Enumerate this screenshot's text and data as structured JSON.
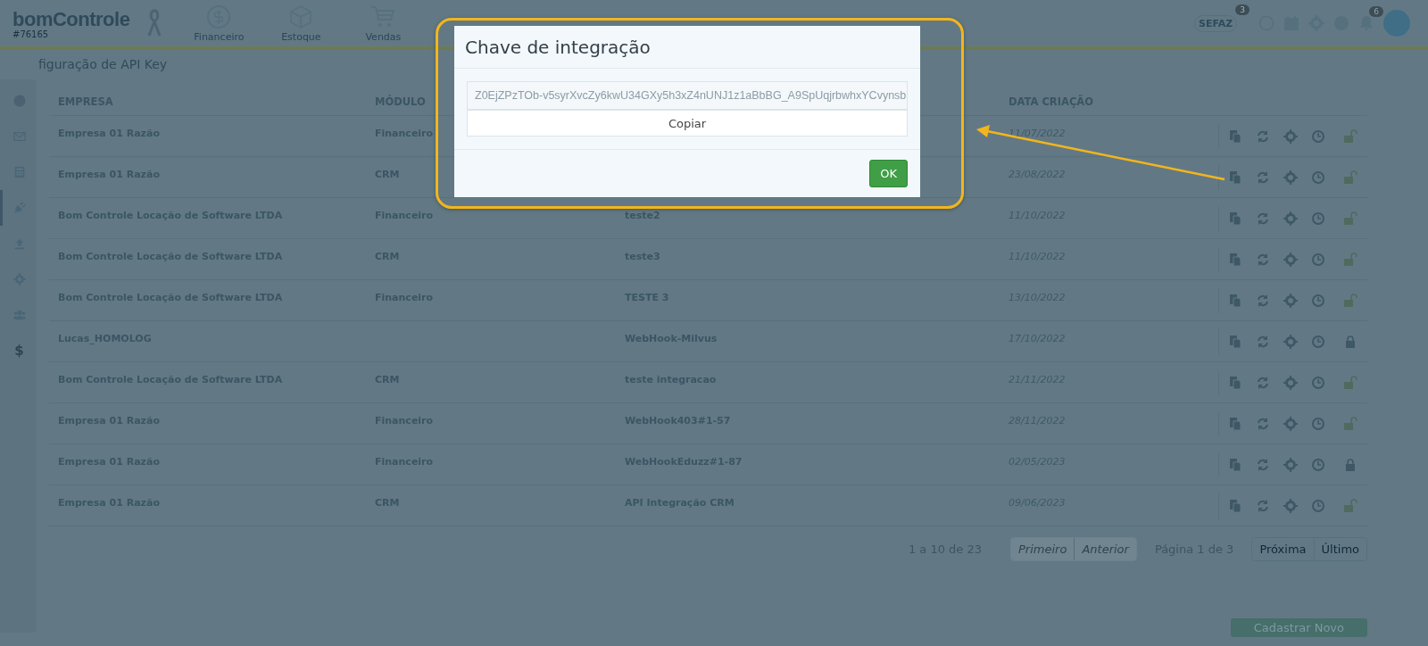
{
  "header": {
    "logo": "bomControle",
    "account": "#76165",
    "nav": [
      {
        "label": "Financeiro",
        "kind": "dollar"
      },
      {
        "label": "Estoque",
        "kind": "box"
      },
      {
        "label": "Vendas",
        "kind": "cart"
      }
    ],
    "sefaz": {
      "label": "SEFAZ",
      "badge": "3"
    },
    "notifications_badge": "6"
  },
  "breadcrumb": "figuração de API Key",
  "sidebar": [
    {
      "kind": "circle",
      "selected": false
    },
    {
      "kind": "mail",
      "selected": false
    },
    {
      "kind": "calc",
      "selected": false
    },
    {
      "kind": "plug",
      "selected": true
    },
    {
      "kind": "upload",
      "selected": false
    },
    {
      "kind": "gear",
      "selected": false
    },
    {
      "kind": "users",
      "selected": false
    },
    {
      "kind": "dollar",
      "selected": false,
      "text": "$"
    }
  ],
  "table": {
    "columns": [
      "EMPRESA",
      "MÓDULO",
      "DATA CRIAÇÃO"
    ],
    "rows": [
      {
        "empresa": "Empresa 01 Razão",
        "modulo": "Financeiro",
        "data": "11/07/2022",
        "locked": false
      },
      {
        "empresa": "Empresa 01 Razão",
        "modulo": "CRM",
        "data": "23/08/2022",
        "locked": false
      },
      {
        "empresa": "Bom Controle Locação de Software LTDA",
        "modulo": "Financeiro",
        "nome": "teste2",
        "data": "11/10/2022",
        "locked": false
      },
      {
        "empresa": "Bom Controle Locação de Software LTDA",
        "modulo": "CRM",
        "nome": "teste3",
        "data": "11/10/2022",
        "locked": false
      },
      {
        "empresa": "Bom Controle Locação de Software LTDA",
        "modulo": "Financeiro",
        "nome": "TESTE 3",
        "data": "13/10/2022",
        "locked": false
      },
      {
        "empresa": "Lucas_HOMOLOG",
        "nome": "WebHook-Milvus",
        "data": "17/10/2022",
        "locked": true
      },
      {
        "empresa": "Bom Controle Locação de Software LTDA",
        "modulo": "CRM",
        "nome": "teste integracao",
        "data": "21/11/2022",
        "locked": false
      },
      {
        "empresa": "Empresa 01 Razão",
        "modulo": "Financeiro",
        "nome": "WebHook403#1-57",
        "data": "28/11/2022",
        "locked": false
      },
      {
        "empresa": "Empresa 01 Razão",
        "modulo": "Financeiro",
        "nome": "WebHookEduzz#1-87",
        "data": "02/05/2023",
        "locked": true
      },
      {
        "empresa": "Empresa 01 Razão",
        "modulo": "CRM",
        "nome": "API Integração CRM",
        "data": "09/06/2023",
        "locked": false
      }
    ]
  },
  "pagination": {
    "summary": "1 a 10 de 23",
    "buttons": [
      {
        "label": "Primeiro",
        "disabled": true
      },
      {
        "label": "Anterior",
        "disabled": true
      }
    ],
    "page": "Página 1 de 3",
    "next_buttons": [
      {
        "label": "Próxima",
        "disabled": false
      },
      {
        "label": "Último",
        "disabled": false
      }
    ]
  },
  "new_button": "Cadastrar Novo",
  "dialog": {
    "title": "Chave de integração",
    "key": "Z0EjZPzTOb-v5syrXvcZy6kwU34GXy5h3xZ4nUNJ1z1aBbBG_A9SpUqjrbwhxYCvynsb",
    "copy": "Copiar",
    "ok": "OK"
  }
}
